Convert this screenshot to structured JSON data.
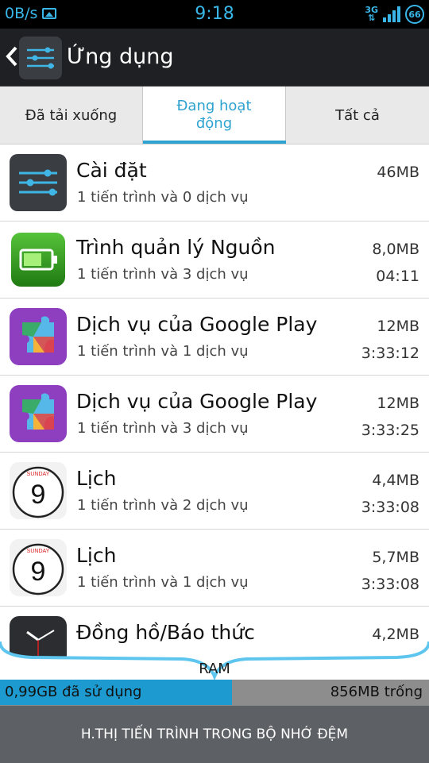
{
  "status_bar": {
    "data_speed": "0B/s",
    "time": "9:18",
    "network": "3G",
    "battery": "66",
    "accent_color": "#39b7e8"
  },
  "action_bar": {
    "title": "Ứng dụng",
    "icon": "settings-sliders-icon"
  },
  "tabs": [
    {
      "label": "Đã tải xuống",
      "selected": false
    },
    {
      "label": "Đang hoạt động",
      "selected": true
    },
    {
      "label": "Tất cả",
      "selected": false
    }
  ],
  "apps": [
    {
      "name": "Cài đặt",
      "detail": "1 tiến trình và 0 dịch vụ",
      "size": "46MB",
      "time": "",
      "icon": "settings-icon"
    },
    {
      "name": "Trình quản lý Nguồn",
      "detail": "1 tiến trình và 3 dịch vụ",
      "size": "8,0MB",
      "time": "04:11",
      "icon": "battery-icon"
    },
    {
      "name": "Dịch vụ của Google Play",
      "detail": "1 tiến trình và 1 dịch vụ",
      "size": "12MB",
      "time": "3:33:12",
      "icon": "google-play-services-icon"
    },
    {
      "name": "Dịch vụ của Google Play",
      "detail": "1 tiến trình và 3 dịch vụ",
      "size": "12MB",
      "time": "3:33:25",
      "icon": "google-play-services-icon"
    },
    {
      "name": "Lịch",
      "detail": "1 tiến trình và 2 dịch vụ",
      "size": "4,4MB",
      "time": "3:33:08",
      "icon": "calendar-icon",
      "icon_text": {
        "day": "SUNDAY",
        "date": "9"
      }
    },
    {
      "name": "Lịch",
      "detail": "1 tiến trình và 1 dịch vụ",
      "size": "5,7MB",
      "time": "3:33:08",
      "icon": "calendar-icon",
      "icon_text": {
        "day": "SUNDAY",
        "date": "9"
      }
    },
    {
      "name": "Đồng hồ/Báo thức",
      "detail": "",
      "size": "4,2MB",
      "time": "",
      "icon": "clock-icon"
    }
  ],
  "ram": {
    "label": "RAM",
    "used": "0,99GB đã sử dụng",
    "free": "856MB trống",
    "used_fraction": 0.54,
    "used_color": "#1d9bd0"
  },
  "footer": {
    "button_label": "H.THỊ TIẾN TRÌNH TRONG BỘ NHỚ ĐỆM"
  }
}
